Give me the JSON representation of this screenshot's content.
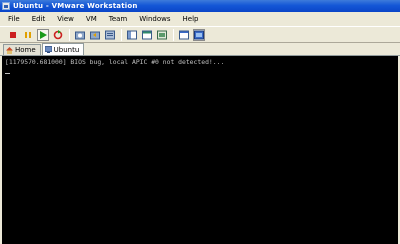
{
  "window": {
    "title": "Ubuntu - VMware Workstation"
  },
  "menu": {
    "items": [
      "File",
      "Edit",
      "View",
      "VM",
      "Team",
      "Windows",
      "Help"
    ]
  },
  "toolbar": {
    "buttons": [
      {
        "icon": "power-off-icon",
        "color": "#cc2020"
      },
      {
        "icon": "pause-icon",
        "color": "#e0a000"
      },
      {
        "icon": "power-on-icon",
        "color": "#1a9a1a"
      },
      {
        "icon": "reset-icon",
        "color": "#cc2020"
      },
      {
        "icon": "snapshot-icon"
      },
      {
        "icon": "revert-snapshot-icon"
      },
      {
        "icon": "snapshot-manager-icon"
      },
      {
        "icon": "show-sidebar-icon"
      },
      {
        "icon": "quick-switch-icon"
      },
      {
        "icon": "summary-view-icon"
      },
      {
        "icon": "console-view-icon"
      },
      {
        "icon": "full-screen-icon"
      }
    ]
  },
  "tabs": [
    {
      "label": "Home",
      "active": false
    },
    {
      "label": "Ubuntu",
      "active": true
    }
  ],
  "console": {
    "line1": "[1179570.681000] BIOS bug, local APIC #0 not detected!..."
  }
}
